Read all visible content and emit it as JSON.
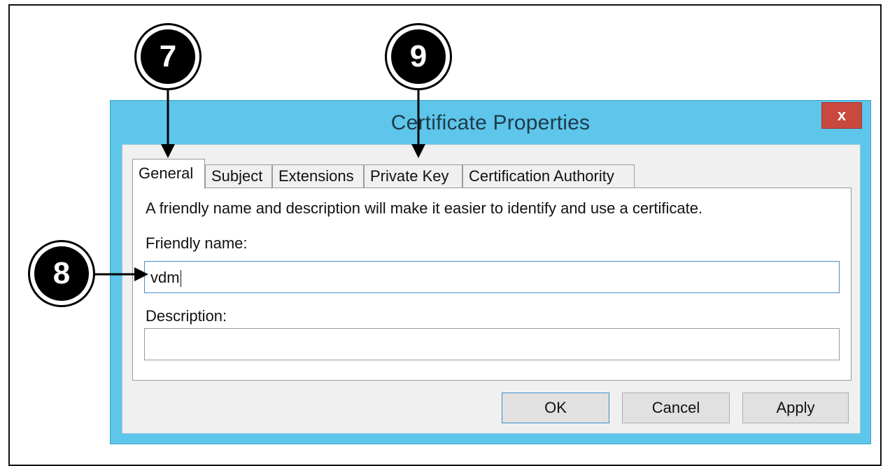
{
  "window": {
    "title": "Certificate Properties",
    "close_label": "x"
  },
  "tabs": [
    {
      "label": "General"
    },
    {
      "label": "Subject"
    },
    {
      "label": "Extensions"
    },
    {
      "label": "Private Key"
    },
    {
      "label": "Certification Authority"
    }
  ],
  "general": {
    "description_text": "A friendly name and description will make it easier to identify and use a certificate.",
    "friendly_name_label": "Friendly name:",
    "friendly_name_value": "vdm",
    "description_label": "Description:",
    "description_value": ""
  },
  "buttons": {
    "ok": "OK",
    "cancel": "Cancel",
    "apply": "Apply"
  },
  "callouts": {
    "c7": "7",
    "c8": "8",
    "c9": "9"
  },
  "colors": {
    "titlebar": "#5ec6ea",
    "close": "#c9493f",
    "callout": "#000000"
  }
}
